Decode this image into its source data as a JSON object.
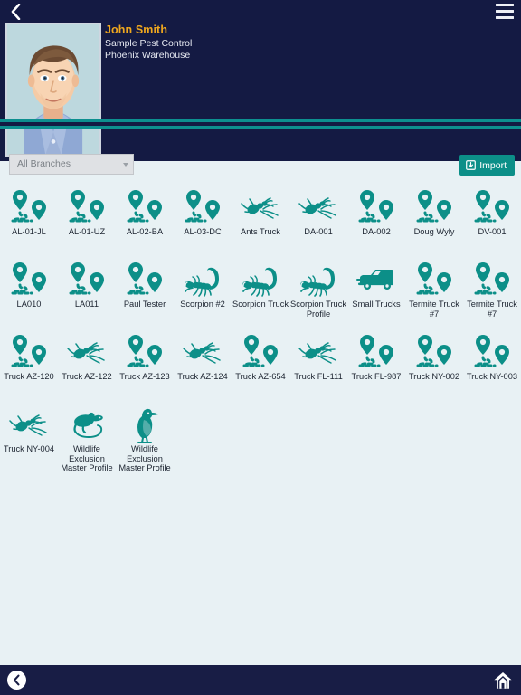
{
  "header": {
    "back_icon": "chevron-left-icon",
    "menu_icon": "hamburger-menu-icon",
    "avatar_alt": "user-avatar",
    "user_name": "John Smith",
    "company": "Sample Pest Control",
    "branch": "Phoenix Warehouse",
    "accent_teal": "#0d8f8f",
    "navy": "#141a43",
    "name_color": "#f0a81e"
  },
  "toolbar": {
    "branch_filter_value": "All Branches",
    "branch_filter_placeholder": "All Branches",
    "import_label": "Import",
    "import_icon": "import-download-icon",
    "import_color": "#0c8f88"
  },
  "grid": {
    "items": [
      {
        "label": "AL-01-JL",
        "icon": "route-pins-icon"
      },
      {
        "label": "AL-01-UZ",
        "icon": "route-pins-icon"
      },
      {
        "label": "AL-02-BA",
        "icon": "route-pins-icon"
      },
      {
        "label": "AL-03-DC",
        "icon": "route-pins-icon"
      },
      {
        "label": "Ants Truck",
        "icon": "ant-icon"
      },
      {
        "label": "DA-001",
        "icon": "ant-icon"
      },
      {
        "label": "DA-002",
        "icon": "route-pins-icon"
      },
      {
        "label": "Doug Wyly",
        "icon": "route-pins-icon"
      },
      {
        "label": "DV-001",
        "icon": "route-pins-icon"
      },
      {
        "label": "LA010",
        "icon": "route-pins-icon"
      },
      {
        "label": "LA011",
        "icon": "route-pins-icon"
      },
      {
        "label": "Paul Tester",
        "icon": "route-pins-icon"
      },
      {
        "label": "Scorpion #2",
        "icon": "scorpion-icon"
      },
      {
        "label": "Scorpion Truck",
        "icon": "scorpion-icon"
      },
      {
        "label": "Scorpion Truck Profile",
        "icon": "scorpion-icon"
      },
      {
        "label": "Small Trucks",
        "icon": "van-icon"
      },
      {
        "label": "Termite Truck #7",
        "icon": "route-pins-icon"
      },
      {
        "label": "Termite Truck #7",
        "icon": "route-pins-icon"
      },
      {
        "label": "Truck AZ-120",
        "icon": "route-pins-icon"
      },
      {
        "label": "Truck AZ-122",
        "icon": "ant-icon"
      },
      {
        "label": "Truck AZ-123",
        "icon": "route-pins-icon"
      },
      {
        "label": "Truck AZ-124",
        "icon": "ant-icon"
      },
      {
        "label": "Truck AZ-654",
        "icon": "route-pins-icon"
      },
      {
        "label": "Truck FL-111",
        "icon": "ant-icon"
      },
      {
        "label": "Truck FL-987",
        "icon": "route-pins-icon"
      },
      {
        "label": "Truck NY-002",
        "icon": "route-pins-icon"
      },
      {
        "label": "Truck NY-003",
        "icon": "route-pins-icon"
      },
      {
        "label": "Truck NY-004",
        "icon": "ant-icon"
      },
      {
        "label": "Wildlife Exclusion Master Profile",
        "icon": "rat-icon"
      },
      {
        "label": "Wildlife Exclusion Master Profile",
        "icon": "bird-icon"
      }
    ],
    "icon_color": "#0c8f88",
    "label_color": "#1c2430",
    "background": "#e8f1f4"
  },
  "bottombar": {
    "back_icon": "circle-chevron-left-icon",
    "home_icon": "home-icon",
    "background": "#181d45"
  }
}
